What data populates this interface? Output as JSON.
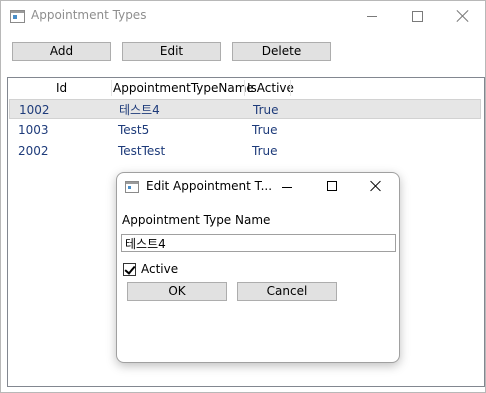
{
  "window": {
    "title": "Appointment Types"
  },
  "toolbar": {
    "add_label": "Add",
    "edit_label": "Edit",
    "delete_label": "Delete"
  },
  "grid": {
    "columns": [
      "Id",
      "AppointmentTypeName",
      "IsActive"
    ],
    "rows": [
      {
        "id": "1002",
        "name": "테스트4",
        "active": "True",
        "selected": true
      },
      {
        "id": "1003",
        "name": "Test5",
        "active": "True",
        "selected": false
      },
      {
        "id": "2002",
        "name": "TestTest",
        "active": "True",
        "selected": false
      }
    ]
  },
  "dialog": {
    "title": "Edit Appointment T...",
    "field_label": "Appointment Type Name",
    "name_value": "테스트4",
    "active_label": "Active",
    "active_checked": true,
    "ok_label": "OK",
    "cancel_label": "Cancel"
  },
  "colors": {
    "cell_text": "#1e3b7a",
    "button_face": "#e1e1e1",
    "selected_row": "#e6e6e6"
  }
}
